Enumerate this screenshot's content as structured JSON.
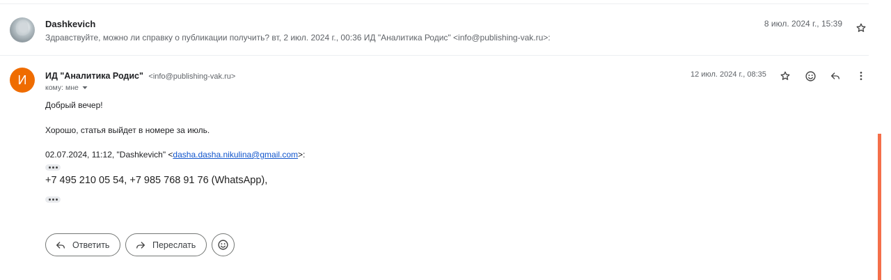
{
  "collapsed_message": {
    "sender": "Dashkevich",
    "snippet": "Здравствуйте, можно ли справку о публикации получить? вт, 2 июл. 2024 г., 00:36 ИД \"Аналитика Родис\" <info@publishing-vak.ru>:",
    "date": "8 июл. 2024 г., 15:39",
    "icons": [
      "avatar-photo",
      "star-icon"
    ]
  },
  "message": {
    "avatar_letter": "И",
    "avatar_color": "#ef6c00",
    "sender_name": "ИД \"Аналитика Родис\"",
    "sender_email": "<info@publishing-vak.ru>",
    "to_label": "кому: мне",
    "date": "12 июл. 2024 г., 08:35",
    "greeting": "Добрый вечер!",
    "body": "Хорошо, статья выйдет в номере за июль.",
    "quote_prefix": "02.07.2024, 11:12, \"Dashkevich\" <",
    "quote_email": "dasha.dasha.nikulina@gmail.com",
    "quote_suffix": ">:",
    "phones": "+7 495 210 05 54, +7 985 768 91 76 (WhatsApp),",
    "header_icons": [
      "star-icon",
      "emoji-icon",
      "reply-icon",
      "more-vert-icon"
    ]
  },
  "actions": {
    "reply_label": "Ответить",
    "forward_label": "Переслать"
  },
  "colors": {
    "link": "#1155cc",
    "scroll_accent": "#f46f4a"
  }
}
